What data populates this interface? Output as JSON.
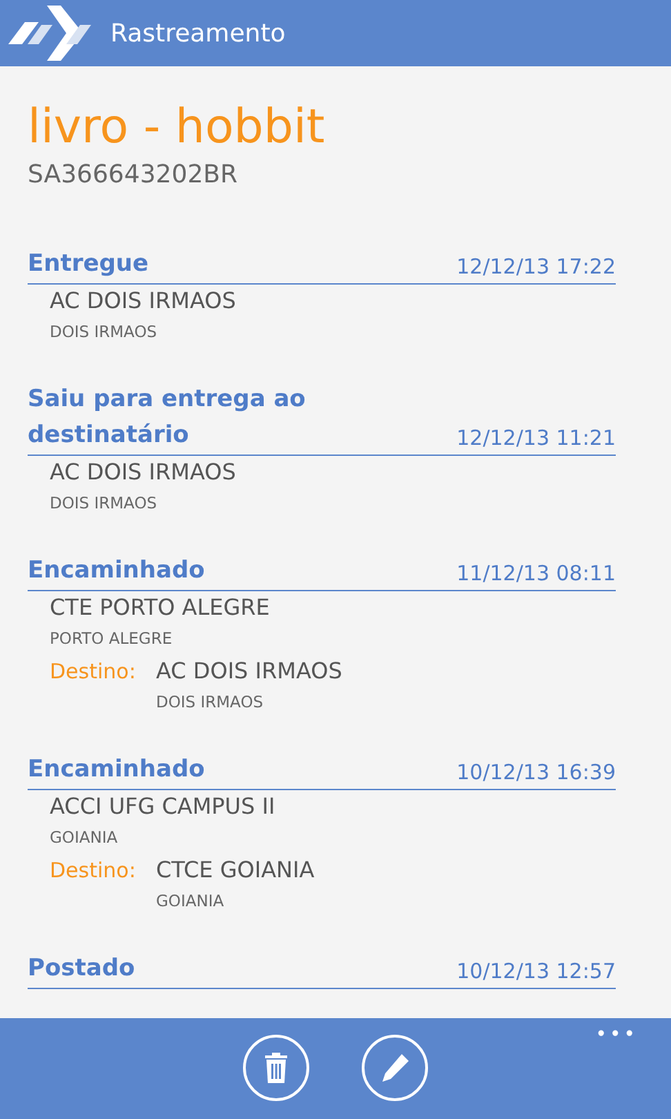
{
  "app_bar": {
    "title": "Rastreamento"
  },
  "package": {
    "name": "livro - hobbit",
    "code": "SA366643202BR"
  },
  "events": [
    {
      "status": "Entregue",
      "datetime": "12/12/13 17:22",
      "location": "AC DOIS IRMAOS",
      "city": "DOIS IRMAOS"
    },
    {
      "status": "Saiu para entrega ao destinatário",
      "datetime": "12/12/13 11:21",
      "location": "AC DOIS IRMAOS",
      "city": "DOIS IRMAOS"
    },
    {
      "status": "Encaminhado",
      "datetime": "11/12/13 08:11",
      "location": "CTE PORTO ALEGRE",
      "city": "PORTO ALEGRE",
      "destination": {
        "label": "Destino:",
        "location": "AC DOIS IRMAOS",
        "city": "DOIS IRMAOS"
      }
    },
    {
      "status": "Encaminhado",
      "datetime": "10/12/13 16:39",
      "location": "ACCI UFG CAMPUS II",
      "city": "GOIANIA",
      "destination": {
        "label": "Destino:",
        "location": "CTCE GOIANIA",
        "city": "GOIANIA"
      }
    },
    {
      "status": "Postado",
      "datetime": "10/12/13 12:57"
    }
  ],
  "bottom_bar": {
    "buttons": [
      {
        "kind": "delete"
      },
      {
        "kind": "edit"
      }
    ],
    "more": "•••"
  }
}
